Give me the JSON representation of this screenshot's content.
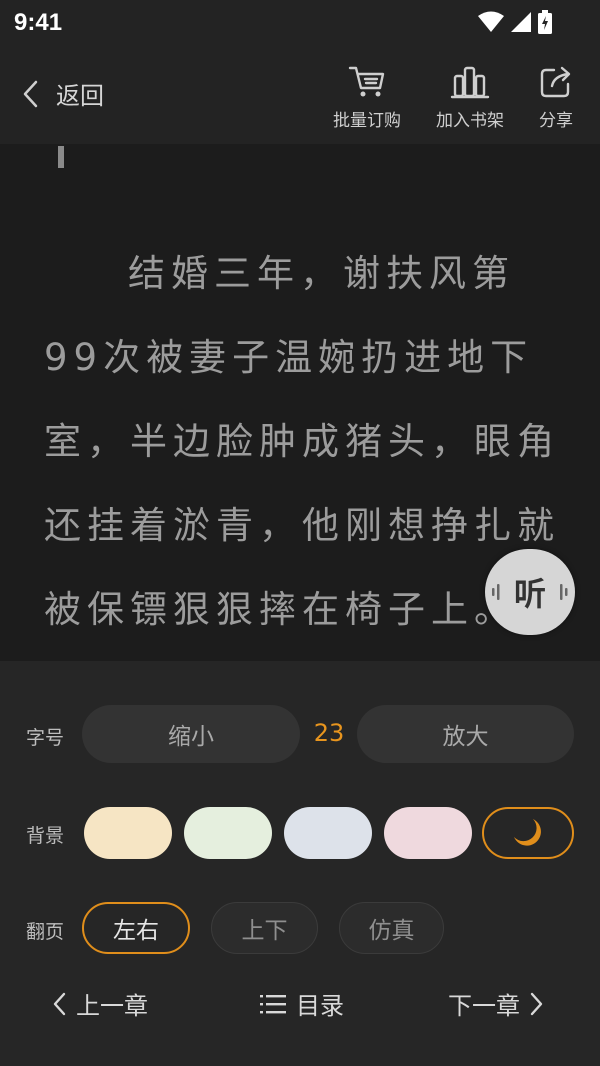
{
  "status": {
    "time": "9:41"
  },
  "header": {
    "back_label": "返回",
    "actions": [
      {
        "label": "批量订购",
        "icon": "cart-icon"
      },
      {
        "label": "加入书架",
        "icon": "bookshelf-icon"
      },
      {
        "label": "分享",
        "icon": "share-icon"
      }
    ]
  },
  "reader": {
    "lines": [
      "结婚三年，谢扶风第",
      "99次被妻子温婉扔进地下",
      "室，半边脸肿成猪头，眼角",
      "还挂着淤青，他刚想挣扎就",
      "被保镖狠狠摔在椅子上。"
    ],
    "listen_label": "听"
  },
  "settings": {
    "font_size": {
      "label": "字号",
      "decrease": "缩小",
      "value": "23",
      "increase": "放大"
    },
    "background": {
      "label": "背景",
      "swatches": [
        "#f6e5c4",
        "#e5efde",
        "#dde2ea",
        "#efd9de"
      ],
      "night_icon": "moon-icon"
    },
    "page_turn": {
      "label": "翻页",
      "options": [
        "左右",
        "上下",
        "仿真"
      ],
      "selected": "左右"
    }
  },
  "nav": {
    "prev": "上一章",
    "toc": "目录",
    "next": "下一章"
  },
  "colors": {
    "accent": "#e08e1b",
    "panel": "#262626",
    "page": "#1c1c1c"
  }
}
